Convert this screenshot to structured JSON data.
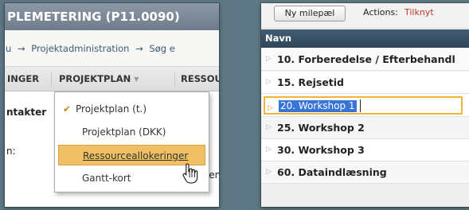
{
  "left": {
    "project_title": "PLEMETERING (P11.0090)",
    "breadcrumb": {
      "part_1": "u",
      "arrow_1": "→",
      "part_2": "Projektadministration",
      "arrow_2": "→",
      "part_3": "Søg e"
    },
    "tabs": {
      "ressourcer_partial": "INGER",
      "projektplan": "PROJEKTPLAN",
      "projektplan_arrow": "▼",
      "ressourcer": "RESSOUR"
    },
    "content": {
      "kontakter_label": "ntakter",
      "an_label": "n:",
      "sen_label": "sen)"
    },
    "dropdown": {
      "checkmark": "✔",
      "items": [
        "Projektplan (t.)",
        "Projektplan (DKK)",
        "Ressourceallokeringer",
        "Gantt-kort"
      ]
    }
  },
  "right": {
    "toolbar": {
      "new_milestone_label": "Ny milepæl",
      "actions_label": "Actions:",
      "actions_link": "Tilknyt"
    },
    "column_header": "Navn",
    "rows": [
      "10. Forberedelse / Efterbehandl",
      "15. Rejsetid",
      "20. Workshop 1",
      "25. Workshop 2",
      "30. Workshop 3",
      "60. Dataindlæsning"
    ],
    "expander_icon": "▷"
  },
  "colors": {
    "background": "#5d7784",
    "title_bar": "#7d8a99",
    "dropdown_highlight": "#f2c064",
    "column_header": "#3a5368",
    "selection": "#3875d7",
    "edit_border": "#f0b33c",
    "link_red": "#c0392b"
  }
}
